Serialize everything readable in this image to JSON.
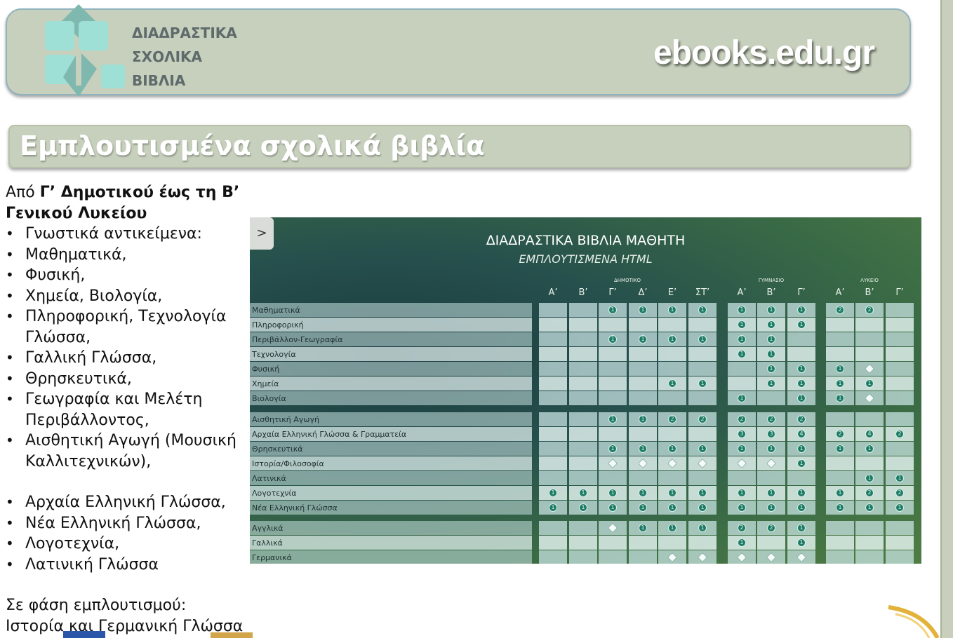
{
  "banner": {
    "logo_lines": [
      "ΔΙΑΔΡΑΣΤΙΚΑ",
      "ΣΧΟΛΙΚΑ",
      "ΒΙΒΛΙΑ"
    ],
    "site": "ebooks.edu.gr",
    "colors": {
      "banner_bg": "#c7d0bd",
      "banner_border": "#8fb3bf",
      "logo_teal": "#8fd3cb"
    }
  },
  "title": "Εμπλουτισμένα σχολικά βιβλία",
  "intro": {
    "prefix": "Από ",
    "bold1": "Γ’ Δημοτικού έως τη Β’",
    "bold2": "Γενικού Λυκείου"
  },
  "bullets_a": [
    "Γνωστικά αντικείμενα:",
    "Μαθηματικά,",
    "Φυσική,",
    "Χημεία, Βιολογία,",
    "Πληροφορική, Τεχνολογία",
    "Γλώσσα,",
    "Γαλλική Γλώσσα,",
    "Θρησκευτικά,",
    "Γεωγραφία και Μελέτη",
    "Περιβάλλοντος,",
    "Αισθητική Αγωγή (Μουσική",
    "Καλλιτεχνικών),"
  ],
  "bullets_b": [
    "Αρχαία Ελληνική Γλώσσα,",
    "Νέα Ελληνική Γλώσσα,",
    "Λογοτεχνία,",
    "Λατινική Γλώσσα"
  ],
  "phase": {
    "label": "Σε φάση εμπλουτισμού:",
    "value": "Ιστορία και Γερμανική Γλώσσα"
  },
  "panel": {
    "toggle": ">",
    "title": "ΔΙΑΔΡΑΣΤΙΚΑ ΒΙΒΛΙΑ ΜΑΘΗΤΗ",
    "subtitle": "ΕΜΠΛΟΥΤΙΣΜΕΝΑ HTML",
    "groups": [
      "ΔΗΜΟΤΙΚΟ",
      "ΓΥΜΝΑΣΙΟ",
      "ΛΥΚΕΙΟ"
    ],
    "columns": [
      "Α’",
      "Β’",
      "Γ’",
      "Δ’",
      "Ε’",
      "ΣΤ’",
      "Α’",
      "Β’",
      "Γ’",
      "Α’",
      "Β’",
      "Γ’"
    ],
    "blocks": [
      [
        {
          "name": "Μαθηματικά",
          "cells": [
            "",
            "",
            "1",
            "1",
            "1",
            "1",
            "1",
            "1",
            "1",
            "2",
            "2",
            ""
          ]
        },
        {
          "name": "Πληροφορική",
          "cells": [
            "",
            "",
            "",
            "",
            "",
            "",
            "1",
            "1",
            "1",
            "",
            "",
            ""
          ]
        },
        {
          "name": "Περιβάλλον-Γεωγραφία",
          "cells": [
            "",
            "",
            "1",
            "1",
            "1",
            "1",
            "1",
            "1",
            "",
            "",
            "",
            ""
          ]
        },
        {
          "name": "Τεχνολογία",
          "cells": [
            "",
            "",
            "",
            "",
            "",
            "",
            "1",
            "1",
            "",
            "",
            "",
            ""
          ]
        },
        {
          "name": "Φυσική",
          "cells": [
            "",
            "",
            "",
            "",
            "",
            "",
            "",
            "1",
            "1",
            "1",
            "o",
            ""
          ]
        },
        {
          "name": "Χημεία",
          "cells": [
            "",
            "",
            "",
            "",
            "1",
            "1",
            "",
            "1",
            "1",
            "1",
            "1",
            ""
          ]
        },
        {
          "name": "Βιολογία",
          "cells": [
            "",
            "",
            "",
            "",
            "",
            "",
            "1",
            "",
            "1",
            "1",
            "o",
            ""
          ]
        }
      ],
      [
        {
          "name": "Αισθητική Αγωγή",
          "cells": [
            "",
            "",
            "1",
            "1",
            "2",
            "2",
            "2",
            "2",
            "2",
            "",
            "",
            ""
          ]
        },
        {
          "name": "Αρχαία Ελληνική Γλώσσα & Γραμματεία",
          "cells": [
            "",
            "",
            "",
            "",
            "",
            "",
            "3",
            "3",
            "4",
            "2",
            "4",
            "2"
          ]
        },
        {
          "name": "Θρησκευτικά",
          "cells": [
            "",
            "",
            "1",
            "1",
            "1",
            "1",
            "1",
            "1",
            "1",
            "1",
            "1",
            ""
          ]
        },
        {
          "name": "Ιστορία/Φιλοσοφία",
          "cells": [
            "",
            "",
            "o",
            "o",
            "o",
            "o",
            "o",
            "o",
            "1",
            "",
            "",
            ""
          ]
        },
        {
          "name": "Λατινικά",
          "cells": [
            "",
            "",
            "",
            "",
            "",
            "",
            "",
            "",
            "",
            "",
            "1",
            "1"
          ]
        },
        {
          "name": "Λογοτεχνία",
          "cells": [
            "1",
            "1",
            "1",
            "1",
            "1",
            "1",
            "1",
            "1",
            "1",
            "1",
            "2",
            "2"
          ]
        },
        {
          "name": "Νέα Ελληνική Γλώσσα",
          "cells": [
            "1",
            "1",
            "1",
            "1",
            "1",
            "1",
            "1",
            "1",
            "1",
            "1",
            "1",
            "1"
          ]
        }
      ],
      [
        {
          "name": "Αγγλικά",
          "cells": [
            "",
            "",
            "o",
            "1",
            "1",
            "1",
            "2",
            "2",
            "1",
            "",
            "",
            ""
          ]
        },
        {
          "name": "Γαλλικά",
          "cells": [
            "",
            "",
            "",
            "",
            "",
            "",
            "1",
            "",
            "1",
            "",
            "",
            ""
          ]
        },
        {
          "name": "Γερμανικά",
          "cells": [
            "",
            "",
            "",
            "",
            "o",
            "o",
            "o",
            "o",
            "o",
            "",
            "",
            ""
          ]
        }
      ]
    ]
  }
}
